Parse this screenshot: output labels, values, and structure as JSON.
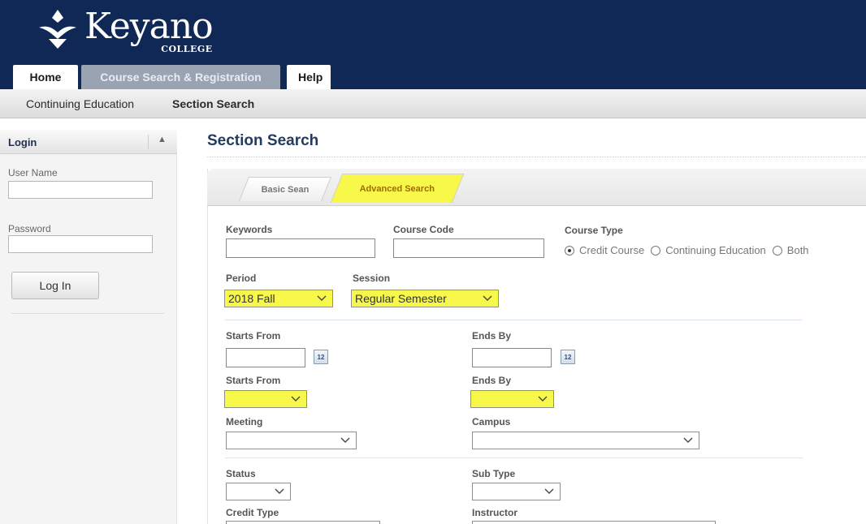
{
  "brand": {
    "name": "Keyano",
    "subtitle": "COLLEGE"
  },
  "top_tabs": [
    {
      "label": "Home"
    },
    {
      "label": "Course Search & Registration"
    },
    {
      "label": "Help"
    }
  ],
  "subnav": {
    "items": [
      "Continuing Education",
      "Section Search"
    ]
  },
  "sidebar": {
    "title": "Login",
    "collapse_icon": "▲",
    "username_label": "User Name",
    "username_value": "",
    "password_label": "Password",
    "password_value": "",
    "login_button": "Log In"
  },
  "main": {
    "title": "Section Search",
    "search_tabs": [
      "Basic Sean",
      "Advanced Search"
    ],
    "fields": {
      "keywords_label": "Keywords",
      "keywords_value": "",
      "course_code_label": "Course Code",
      "course_code_value": "",
      "course_type_label": "Course Type",
      "course_type_options": [
        "Credit Course",
        "Continuing Education",
        "Both"
      ],
      "course_type_selected": "Credit Course",
      "period_label": "Period",
      "period_value": "2018 Fall",
      "session_label": "Session",
      "session_value": "Regular Semester",
      "starts_from_label": "Starts From",
      "starts_from_value": "",
      "ends_by_label": "Ends By",
      "ends_by_value": "",
      "calendar_icon_text": "12",
      "starts_from_time_label": "Starts From",
      "starts_from_time_value": "",
      "ends_by_time_label": "Ends By",
      "ends_by_time_value": "",
      "meeting_label": "Meeting",
      "meeting_value": "",
      "campus_label": "Campus",
      "campus_value": "",
      "status_label": "Status",
      "status_value": "",
      "sub_type_label": "Sub Type",
      "sub_type_value": "",
      "credit_type_label": "Credit Type",
      "instructor_label": "Instructor"
    }
  },
  "colors": {
    "header": "#0f2856",
    "highlight": "#f7f84a",
    "title": "#233b61"
  }
}
